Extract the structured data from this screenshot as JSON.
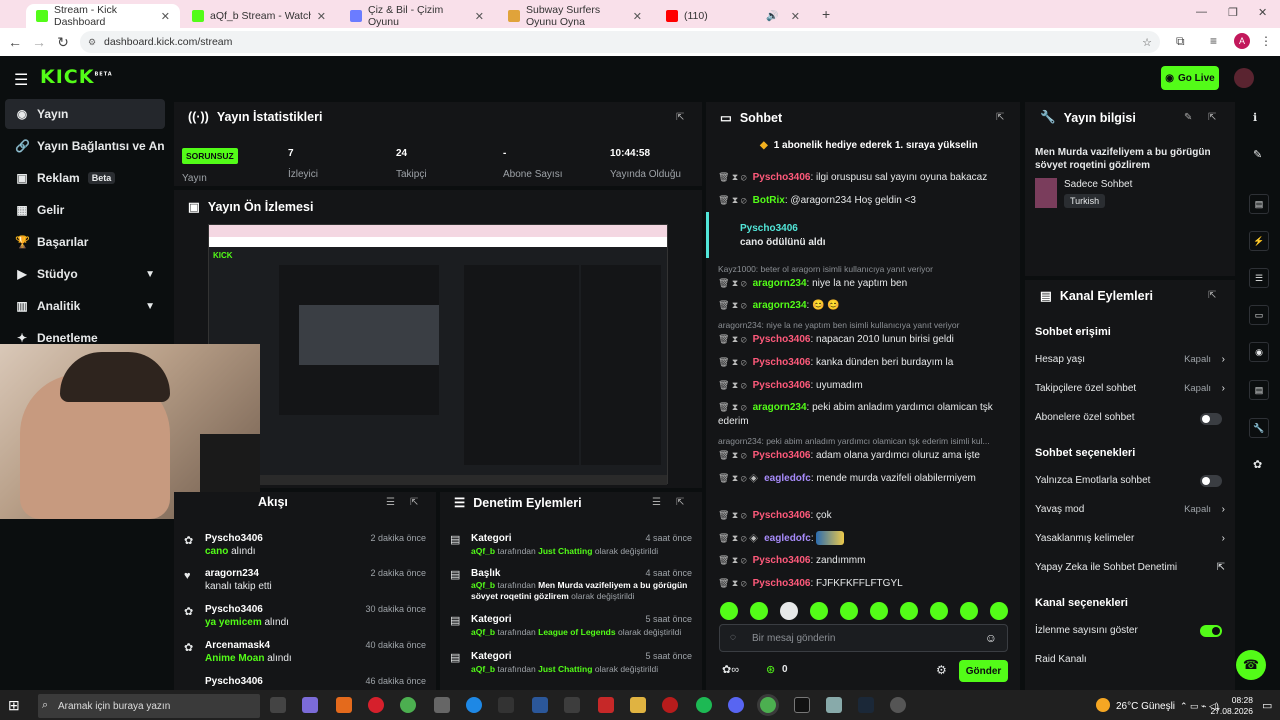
{
  "browser": {
    "tabs": [
      {
        "title": "Stream - Kick Dashboard",
        "color": "#53fc18"
      },
      {
        "title": "aQf_b Stream - Watch Live on K",
        "color": "#53fc18"
      },
      {
        "title": "Çiz & Bil - Çizim Oyunu",
        "color": "#6b7cff"
      },
      {
        "title": "Subway Surfers Oyunu Oyna",
        "color": "#e0a33a"
      },
      {
        "title": "(110)",
        "color": "#ff0000"
      }
    ],
    "url": "dashboard.kick.com/stream",
    "profile_initial": "A"
  },
  "header": {
    "logo": "KICK",
    "logo_sup": "BETA",
    "go_live": "Go Live"
  },
  "sidebar": {
    "items": [
      {
        "label": "Yayın",
        "icon": "broadcast-icon"
      },
      {
        "label": "Yayın Bağlantısı ve Anahtar",
        "icon": "link-icon"
      },
      {
        "label": "Reklam",
        "icon": "ad-icon",
        "badge": "Beta"
      },
      {
        "label": "Gelir",
        "icon": "revenue-icon"
      },
      {
        "label": "Başarılar",
        "icon": "trophy-icon"
      },
      {
        "label": "Stüdyo",
        "icon": "studio-icon"
      },
      {
        "label": "Analitik",
        "icon": "analytics-icon"
      },
      {
        "label": "Denetleme",
        "icon": "moderation-icon"
      }
    ]
  },
  "stats": {
    "title": "Yayın İstatistikleri",
    "status": "SORUNSUZ",
    "items": [
      {
        "value": "",
        "label": "Yayın"
      },
      {
        "value": "7",
        "label": "İzleyici"
      },
      {
        "value": "24",
        "label": "Takipçi"
      },
      {
        "value": "-",
        "label": "Abone Sayısı"
      },
      {
        "value": "10:44:58",
        "label": "Yayında Olduğu Süre"
      }
    ]
  },
  "preview": {
    "title": "Yayın Ön İzlemesi"
  },
  "activity": {
    "title": "Akışı",
    "items": [
      {
        "name": "Pyscho3406",
        "action_highlight": "cano",
        "action": "alındı",
        "time": "2 dakika önce"
      },
      {
        "name": "aragorn234",
        "action_highlight": "",
        "action": "kanalı takip etti",
        "time": "2 dakika önce"
      },
      {
        "name": "Pyscho3406",
        "action_highlight": "ya yemicem",
        "action": "alındı",
        "time": "30 dakika önce"
      },
      {
        "name": "Arcenamask4",
        "action_highlight": "Anime Moan",
        "action": "alındı",
        "time": "40 dakika önce"
      },
      {
        "name": "Pyscho3406",
        "action_highlight": "",
        "action": "",
        "time": "46 dakika önce"
      }
    ]
  },
  "modactions": {
    "title": "Denetim Eylemleri",
    "items": [
      {
        "type": "Kategori",
        "user": "aQf_b",
        "mid": "tarafından",
        "value": "Just Chatting",
        "suffix": "olarak değiştirildi",
        "time": "4 saat önce"
      },
      {
        "type": "Başlık",
        "user": "aQf_b",
        "mid": "tarafından",
        "value": "Men Murda vazifeliyem a bu görügün sövyet roqetini gözlirem",
        "suffix": "olarak değiştirildi",
        "time": "4 saat önce"
      },
      {
        "type": "Kategori",
        "user": "aQf_b",
        "mid": "tarafından",
        "value": "League of Legends",
        "suffix": "olarak değiştirildi",
        "time": "5 saat önce"
      },
      {
        "type": "Kategori",
        "user": "aQf_b",
        "mid": "tarafından",
        "value": "Just Chatting",
        "suffix": "olarak değiştirildi",
        "time": "5 saat önce"
      }
    ]
  },
  "chat": {
    "title": "Sohbet",
    "pinned": "1 abonelik hediye ederek 1. sıraya yükselin",
    "messages": [
      {
        "user": "Pyscho3406",
        "text": ": ilgi oruspusu sal yayını oyuna bakacaz",
        "color": "red"
      },
      {
        "user": "BotRix",
        "text": ": @aragorn234 Hoş geldin <3",
        "color": "green"
      },
      {
        "user": "Pyscho3406",
        "text": "cano ödülünü aldı",
        "color": "cyan",
        "reward": true
      },
      {
        "reply": "Kayz1000: beter ol aragorn isimli kullanıcıya yanıt veriyor"
      },
      {
        "user": "aragorn234",
        "text": ": niye la ne yaptım ben",
        "color": "green"
      },
      {
        "user": "aragorn234",
        "text": ": 😊 😊",
        "color": "green"
      },
      {
        "reply": "aragorn234: niye la ne yaptım ben isimli kullanıcıya yanıt veriyor"
      },
      {
        "user": "Pyscho3406",
        "text": ": napacan 2010 lunun birisi geldi",
        "color": "red"
      },
      {
        "user": "Pyscho3406",
        "text": ": kanka dünden beri burdayım la",
        "color": "red"
      },
      {
        "user": "Pyscho3406",
        "text": ": uyumadım",
        "color": "red"
      },
      {
        "user": "aragorn234",
        "text": ": peki abim anladım yardımcı olamican tşk ederim",
        "color": "green"
      },
      {
        "reply": "aragorn234: peki abim anladım yardımcı olamican tşk ederim isimli kul..."
      },
      {
        "user": "Pyscho3406",
        "text": ": adam olana yardımcı oluruz ama işte",
        "color": "red"
      },
      {
        "user": "eagledofc",
        "text": ": mende murda vazifeli olabilermiyem",
        "color": "purple"
      },
      {
        "user": "Pyscho3406",
        "text": ": çok",
        "color": "red"
      },
      {
        "user": "eagledofc",
        "text": ":",
        "color": "purple"
      },
      {
        "user": "Pyscho3406",
        "text": ": zandımmm",
        "color": "red"
      },
      {
        "user": "Pyscho3406",
        "text": ": FJFKFKFFLFTGYL",
        "color": "red"
      }
    ],
    "input_placeholder": "Bir mesaj gönderin",
    "points": "0",
    "send": "Gönder"
  },
  "streaminfo": {
    "title": "Yayın bilgisi",
    "stream_title": "Men Murda vazifeliyem a bu görügün sövyet roqetini gözlirem",
    "category": "Sadece Sohbet",
    "language": "Turkish"
  },
  "channel": {
    "title": "Kanal Eylemleri",
    "chat_access": "Sohbet erişimi",
    "rows1": [
      {
        "label": "Hesap yaşı",
        "value": "Kapalı"
      },
      {
        "label": "Takipçilere özel sohbet",
        "value": "Kapalı"
      },
      {
        "label": "Abonelere özel sohbet",
        "value": ""
      }
    ],
    "chat_options": "Sohbet seçenekleri",
    "rows2": [
      {
        "label": "Yalnızca Emotlarla sohbet",
        "value": ""
      },
      {
        "label": "Yavaş mod",
        "value": "Kapalı"
      },
      {
        "label": "Yasaklanmış kelimeler",
        "value": ""
      },
      {
        "label": "Yapay Zeka ile Sohbet Denetimi",
        "value": ""
      }
    ],
    "channel_options": "Kanal seçenekleri",
    "rows3": [
      {
        "label": "İzlenme sayısını göster",
        "value": ""
      },
      {
        "label": "Raid Kanalı",
        "value": ""
      }
    ]
  },
  "taskbar": {
    "search": "Aramak için buraya yazın",
    "weather": "26°C Güneşli",
    "time": "08:28",
    "date": "27.08.2026"
  }
}
